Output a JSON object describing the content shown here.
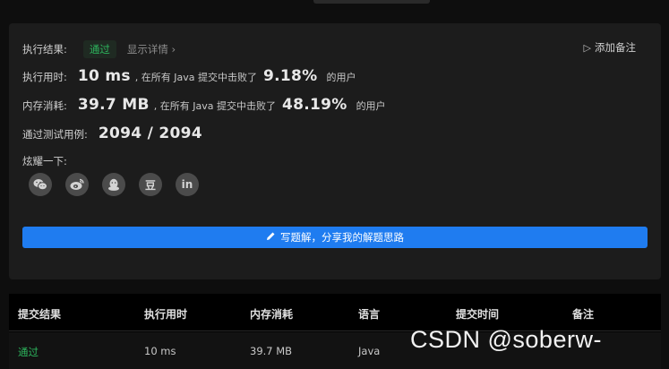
{
  "result": {
    "label": "执行结果:",
    "status": "通过",
    "details_link": "显示详情 ›",
    "add_note": "添加备注",
    "runtime": {
      "label": "执行用时:",
      "value": "10 ms",
      "text": ", 在所有 Java 提交中击败了",
      "percent": "9.18%",
      "suffix": "的用户"
    },
    "memory": {
      "label": "内存消耗:",
      "value": "39.7 MB",
      "text": ", 在所有 Java 提交中击败了",
      "percent": "48.19%",
      "suffix": "的用户"
    },
    "tests": {
      "label": "通过测试用例:",
      "value": "2094 / 2094"
    },
    "share": {
      "label": "炫耀一下:",
      "icons": [
        "wechat-icon",
        "weibo-icon",
        "qq-icon",
        "douban-icon",
        "linkedin-icon"
      ],
      "douban_glyph": "豆",
      "linkedin_glyph": "in"
    },
    "write_solution": "写题解，分享我的解题思路"
  },
  "submissions": {
    "headers": [
      "提交结果",
      "执行用时",
      "内存消耗",
      "语言",
      "提交时间",
      "备注"
    ],
    "rows": [
      {
        "status": "通过",
        "runtime": "10 ms",
        "memory": "39.7 MB",
        "language": "Java"
      }
    ]
  },
  "watermark": "CSDN @soberw-",
  "colors": {
    "accent": "#1f7cf0",
    "pass": "#2db55d",
    "panel": "#1c1c1c"
  }
}
